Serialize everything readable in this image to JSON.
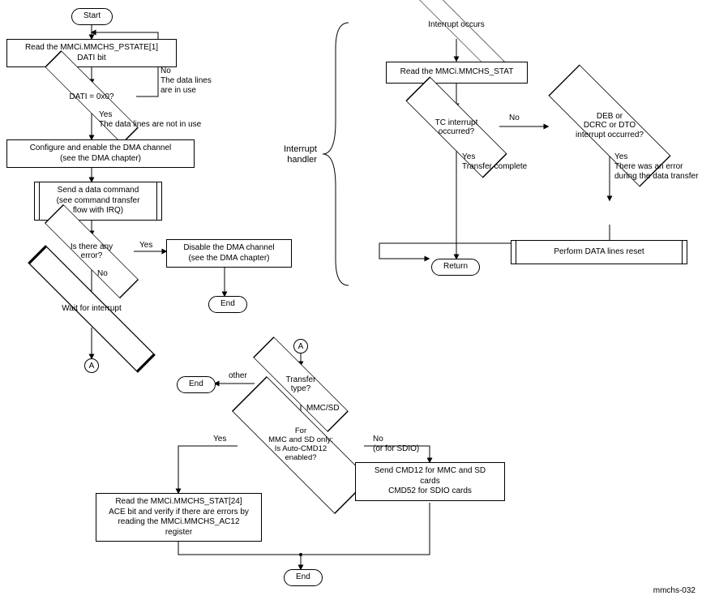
{
  "left": {
    "start": "Start",
    "readPstate": "Read the MMCi.MMCHS_PSTATE[1]\nDATI bit",
    "datiQ": "DATI = 0x0?",
    "datiNo": "No\nThe data lines\nare in use",
    "datiYes": "Yes\nThe data lines are not in use",
    "cfgDma": "Configure and enable the DMA channel\n(see the DMA chapter)",
    "sendCmd": "Send a data command\n(see command transfer\nflow with IRQ)",
    "errQ": "Is there any\nerror?",
    "errYes": "Yes",
    "errNo": "No",
    "disableDma": "Disable the DMA channel\n(see the DMA chapter)",
    "end1": "End",
    "wait": "Wait for interrupt",
    "connA": "A"
  },
  "ih": {
    "title": "Interrupt\nhandler",
    "intOccurs": "Interrupt occurs",
    "readStat": "Read the MMCi.MMCHS_STAT",
    "tcQ": "TC interrupt\noccurred?",
    "tcNo": "No",
    "tcYes": "Yes\nTransfer complete",
    "debQ": "DEB or\nDCRC or DTO\ninterrupt occurred?",
    "debYes": "Yes\nThere was an error\nduring the data transfer",
    "reset": "Perform DATA lines reset",
    "ret": "Return"
  },
  "bottom": {
    "connA": "A",
    "typeQ": "Transfer\ntype?",
    "typeOther": "other",
    "typeMmcsd": "MMC/SD",
    "end2": "End",
    "autoQ": "For\nMMC and SD only:\nIs Auto-CMD12\nenabled?",
    "autoYes": "Yes",
    "autoNo": "No\n(or for SDIO)",
    "readAce": "Read the MMCi.MMCHS_STAT[24]\nACE bit and verify if there are errors by\nreading the MMCi.MMCHS_AC12\nregister",
    "sendCmd12": "Send CMD12 for MMC and SD\ncards\nCMD52 for SDIO cards",
    "end3": "End"
  },
  "imageId": "mmchs-032"
}
